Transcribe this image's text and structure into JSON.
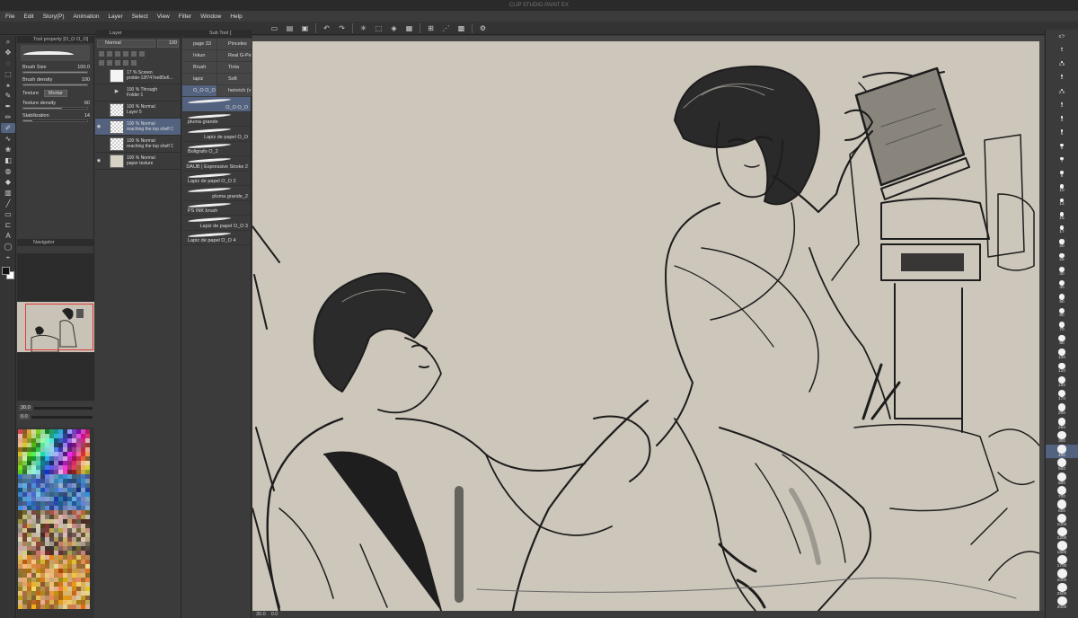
{
  "window": {
    "title": "CLIP STUDIO PAINT EX"
  },
  "menu": [
    "File",
    "Edit",
    "Story(P)",
    "Animation",
    "Layer",
    "Select",
    "View",
    "Filter",
    "Window",
    "Help"
  ],
  "tool_property": {
    "tab": "Tool property [O_O O_O]",
    "brush_size_label": "Brush Size",
    "brush_size": "100.0",
    "brush_size_fill": 1.0,
    "brush_density_label": "Brush density",
    "brush_density": "100",
    "brush_density_fill": 1.0,
    "texture_label": "Texture",
    "texture_value": "Mortar",
    "texture_density_label": "Texture density",
    "texture_density": "60",
    "texture_density_fill": 0.6,
    "stabilization_label": "Stabilization",
    "stabilization": "14",
    "stabilization_fill": 0.14
  },
  "navigator": {
    "tab": "Navigator",
    "zoom": "30.0",
    "rotation": "0.0"
  },
  "layer_panel": {
    "tab": "Layer",
    "blend_mode": "Normal",
    "opacity": "100",
    "layers": [
      {
        "line1": "17 % Screen",
        "line2": "proble-12f747ee85e6...",
        "thumb": "plain",
        "visible": false,
        "active": false
      },
      {
        "line1": "100 % Through",
        "line2": "Folder 1",
        "thumb": "folder",
        "visible": false,
        "active": false
      },
      {
        "line1": "100 % Normal",
        "line2": "Layer 5",
        "thumb": "check",
        "visible": false,
        "active": false
      },
      {
        "line1": "100 % Normal",
        "line2": "reaching the top shelf Copy",
        "thumb": "check",
        "visible": true,
        "active": true
      },
      {
        "line1": "100 % Normal",
        "line2": "reaching the top shelf Copy",
        "thumb": "check",
        "visible": false,
        "active": false
      },
      {
        "line1": "100 % Normal",
        "line2": "paper texture",
        "thumb": "paper",
        "visible": true,
        "active": false
      }
    ]
  },
  "sub_tool": {
    "tab": "Sub Tool [",
    "groups": [
      "page 33",
      "Pinceles",
      "Inkun",
      "Real G-Pe",
      "Brush",
      "Tinta",
      "lapiz",
      "Soft",
      "O_O O_O",
      "heinrich (v"
    ],
    "active_group": 8,
    "brushes": [
      {
        "name": "O_O O_O",
        "active": true
      },
      {
        "name": "pluma grande",
        "active": false
      },
      {
        "name": "Lapiz de papel O_O",
        "active": false
      },
      {
        "name": "Boligrafo O_2",
        "active": false
      },
      {
        "name": "DAUB | Expressive Stroke 2",
        "active": false
      },
      {
        "name": "Lapiz de papel O_O 2",
        "active": false
      },
      {
        "name": "pluma grande_2",
        "active": false
      },
      {
        "name": "PS INK brush",
        "active": false
      },
      {
        "name": "Lapiz de papel O_O 3",
        "active": false
      },
      {
        "name": "Lapiz de papel O_O 4",
        "active": false
      }
    ]
  },
  "brush_sizes": {
    "tab": "",
    "items": [
      "0.7",
      "1",
      "1.5",
      "2",
      "2.5",
      "3",
      "4",
      "5",
      "6",
      "7",
      "8",
      "10",
      "12",
      "15",
      "17",
      "20",
      "25",
      "30",
      "40",
      "50",
      "60",
      "70",
      "80",
      "100",
      "120",
      "150",
      "170",
      "200",
      "250",
      "300",
      "400",
      "500",
      "600",
      "700",
      "800",
      "1000",
      "1200",
      "1500",
      "1700",
      "2000",
      "2500",
      "3000"
    ],
    "active_index": 30
  },
  "status": {
    "zoom": "30.0",
    "angle": "0.0"
  },
  "colors": {
    "active_highlight": "#53627f",
    "paper": "#cdc7bb",
    "ink": "#1a1a1a"
  }
}
